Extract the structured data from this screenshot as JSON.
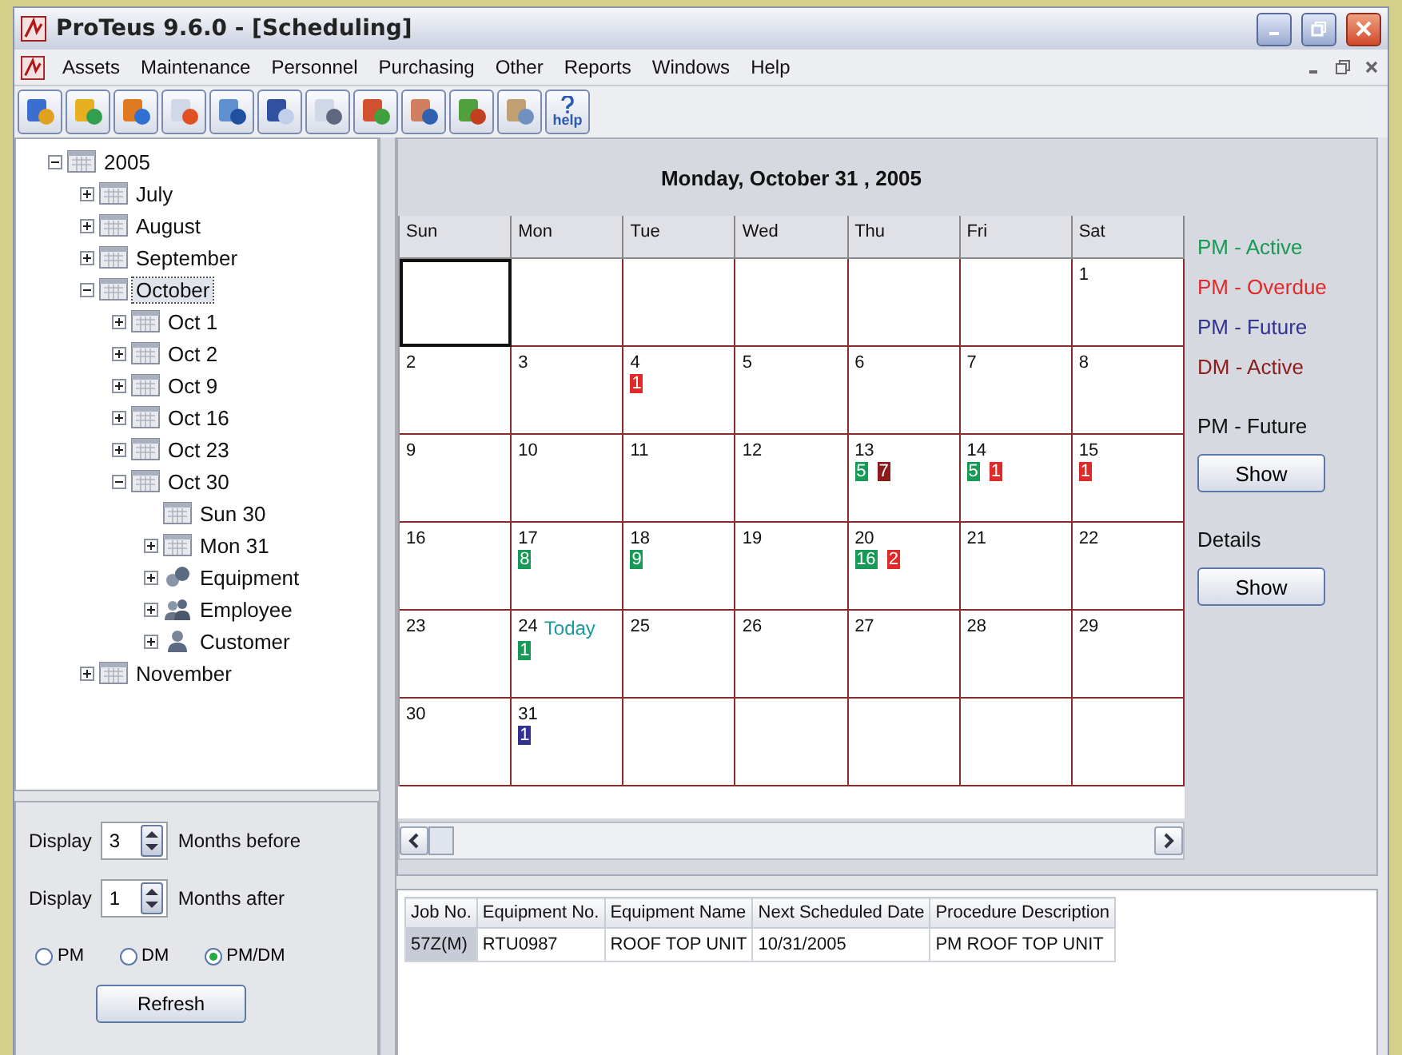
{
  "window": {
    "title": "ProTeus 9.6.0 - [Scheduling]"
  },
  "menu": [
    "Assets",
    "Maintenance",
    "Personnel",
    "Purchasing",
    "Other",
    "Reports",
    "Windows",
    "Help"
  ],
  "toolbar": {
    "help_label": "help"
  },
  "tree": [
    {
      "label": "2005",
      "kind": "calendar",
      "expanded": true,
      "selected": false,
      "children": [
        {
          "label": "July",
          "kind": "calendar",
          "expanded": false,
          "selected": false
        },
        {
          "label": "August",
          "kind": "calendar",
          "expanded": false,
          "selected": false
        },
        {
          "label": "September",
          "kind": "calendar",
          "expanded": false,
          "selected": false
        },
        {
          "label": "October",
          "kind": "calendar",
          "expanded": true,
          "selected": true,
          "children": [
            {
              "label": "Oct 1",
              "kind": "calendar",
              "expanded": false,
              "selected": false
            },
            {
              "label": "Oct 2",
              "kind": "calendar",
              "expanded": false,
              "selected": false
            },
            {
              "label": "Oct 9",
              "kind": "calendar",
              "expanded": false,
              "selected": false
            },
            {
              "label": "Oct 16",
              "kind": "calendar",
              "expanded": false,
              "selected": false
            },
            {
              "label": "Oct 23",
              "kind": "calendar",
              "expanded": false,
              "selected": false
            },
            {
              "label": "Oct 30",
              "kind": "calendar",
              "expanded": true,
              "selected": false,
              "children": [
                {
                  "label": "Sun 30",
                  "kind": "calendar",
                  "selected": false
                },
                {
                  "label": "Mon 31",
                  "kind": "calendar",
                  "expanded": false,
                  "selected": false
                },
                {
                  "label": "Equipment",
                  "kind": "equipment",
                  "expanded": false,
                  "selected": false
                },
                {
                  "label": "Employee",
                  "kind": "employee",
                  "expanded": false,
                  "selected": false
                },
                {
                  "label": "Customer",
                  "kind": "customer",
                  "expanded": false,
                  "selected": false
                }
              ]
            }
          ]
        },
        {
          "label": "November",
          "kind": "calendar",
          "expanded": false,
          "selected": false
        }
      ]
    }
  ],
  "display": [
    {
      "label": "Display",
      "value": "3",
      "suffix": "Months before"
    },
    {
      "label": "Display",
      "value": "1",
      "suffix": "Months after"
    }
  ],
  "filter": [
    {
      "label": "PM",
      "selected": false
    },
    {
      "label": "DM",
      "selected": false
    },
    {
      "label": "PM/DM",
      "selected": true
    }
  ],
  "refresh_button": "Refresh",
  "calendar": {
    "title": "Monday, October 31 , 2005",
    "weekdays": [
      "Sun",
      "Mon",
      "Tue",
      "Wed",
      "Thu",
      "Fri",
      "Sat"
    ],
    "weeks": [
      [
        {
          "selected": true
        },
        {
          "selected": false
        },
        {
          "selected": false
        },
        {
          "selected": false
        },
        {
          "selected": false
        },
        {
          "selected": false
        },
        {
          "day": "1",
          "selected": false
        }
      ],
      [
        {
          "day": "2",
          "selected": false
        },
        {
          "day": "3",
          "selected": false
        },
        {
          "day": "4",
          "selected": false,
          "badges": [
            {
              "count": "1",
              "color": "#e02a2a"
            }
          ]
        },
        {
          "day": "5",
          "selected": false
        },
        {
          "day": "6",
          "selected": false
        },
        {
          "day": "7",
          "selected": false
        },
        {
          "day": "8",
          "selected": false
        }
      ],
      [
        {
          "day": "9",
          "selected": false
        },
        {
          "day": "10",
          "selected": false
        },
        {
          "day": "11",
          "selected": false
        },
        {
          "day": "12",
          "selected": false
        },
        {
          "day": "13",
          "selected": false,
          "badges": [
            {
              "count": "5",
              "color": "#169a55"
            },
            {
              "count": "7",
              "color": "#8c1c1c"
            }
          ]
        },
        {
          "day": "14",
          "selected": false,
          "badges": [
            {
              "count": "5",
              "color": "#169a55"
            },
            {
              "count": "1",
              "color": "#e02a2a"
            }
          ]
        },
        {
          "day": "15",
          "selected": false,
          "badges": [
            {
              "count": "1",
              "color": "#e02a2a"
            }
          ]
        }
      ],
      [
        {
          "day": "16",
          "selected": false
        },
        {
          "day": "17",
          "selected": false,
          "badges": [
            {
              "count": "8",
              "color": "#169a55"
            }
          ]
        },
        {
          "day": "18",
          "selected": false,
          "badges": [
            {
              "count": "9",
              "color": "#169a55"
            }
          ]
        },
        {
          "day": "19",
          "selected": false
        },
        {
          "day": "20",
          "selected": false,
          "badges": [
            {
              "count": "16",
              "color": "#169a55"
            },
            {
              "count": "2",
              "color": "#e02a2a"
            }
          ]
        },
        {
          "day": "21",
          "selected": false
        },
        {
          "day": "22",
          "selected": false
        }
      ],
      [
        {
          "day": "23",
          "selected": false
        },
        {
          "day": "24",
          "today_label": "Today",
          "selected": false,
          "badges": [
            {
              "count": "1",
              "color": "#169a55"
            }
          ]
        },
        {
          "day": "25",
          "selected": false
        },
        {
          "day": "26",
          "selected": false
        },
        {
          "day": "27",
          "selected": false
        },
        {
          "day": "28",
          "selected": false
        },
        {
          "day": "29",
          "selected": false
        }
      ],
      [
        {
          "day": "30",
          "selected": false
        },
        {
          "day": "31",
          "selected": false,
          "badges": [
            {
              "count": "1",
              "color": "#33338f"
            }
          ]
        },
        {
          "selected": false
        },
        {
          "selected": false
        },
        {
          "selected": false
        },
        {
          "selected": false
        },
        {
          "selected": false
        }
      ]
    ]
  },
  "legend": [
    {
      "label": "PM - Active",
      "color": "#169a55"
    },
    {
      "label": "PM - Overdue",
      "color": "#e02a2a"
    },
    {
      "label": "PM - Future",
      "color": "#33338f"
    },
    {
      "label": "DM - Active",
      "color": "#8c1c1c"
    }
  ],
  "toggles": [
    {
      "label": "PM - Future",
      "button": "Show"
    },
    {
      "label": "Details",
      "button": "Show"
    }
  ],
  "table": {
    "columns": [
      "Job No.",
      "Equipment No.",
      "Equipment Name",
      "Next Scheduled Date",
      "Procedure Description"
    ],
    "rows": [
      [
        "57Z(M)",
        "RTU0987",
        "ROOF TOP UNIT",
        "10/31/2005",
        "PM ROOF TOP UNIT"
      ]
    ]
  }
}
